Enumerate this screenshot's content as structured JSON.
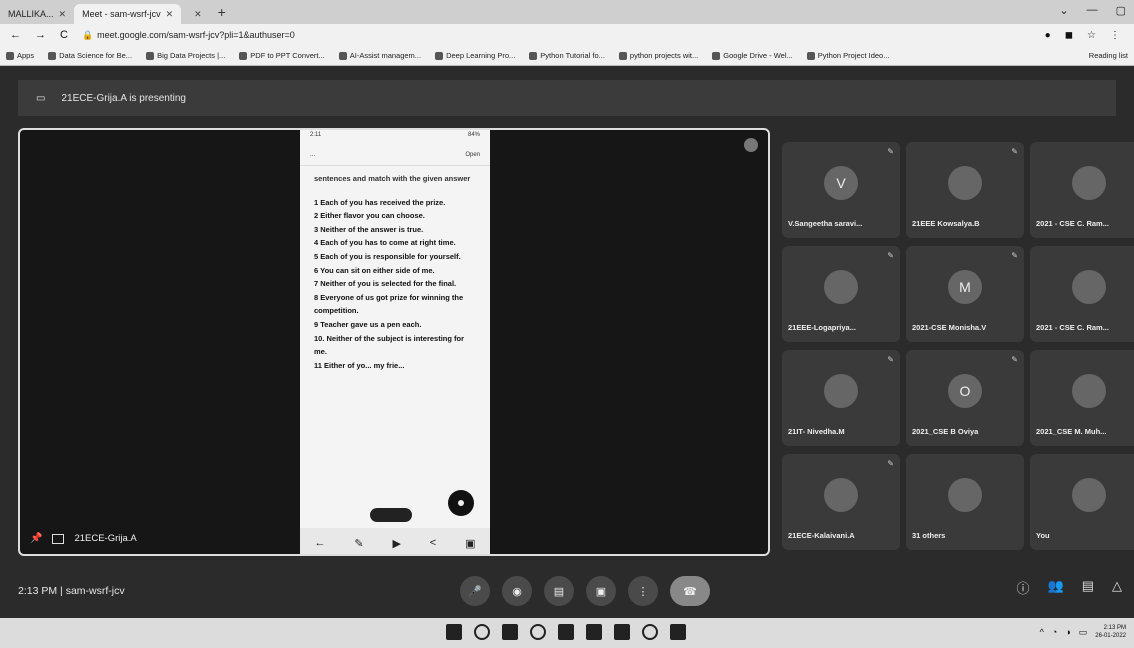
{
  "browser": {
    "tabs": [
      {
        "title": "MALLIKA...",
        "active": false
      },
      {
        "title": "Meet - sam-wsrf-jcv",
        "active": true
      },
      {
        "title": "",
        "active": false
      }
    ],
    "url": "meet.google.com/sam-wsrf-jcv?pli=1&authuser=0",
    "bookmarks": [
      "Apps",
      "Data Science for Be...",
      "Big Data Projects |...",
      "PDF to PPT Convert...",
      "AI-Assist managem...",
      "Deep Learning Pro...",
      "Python Tutorial fo...",
      "python projects wit...",
      "Google Drive - Wel...",
      "Python Project Ideo..."
    ],
    "bookmarks_right": "Reading list"
  },
  "meet": {
    "presenting_text": "21ECE-Grija.A is presenting",
    "presenter_label": "21ECE-Grija.A",
    "meeting_time": "2:13 PM",
    "meeting_code": "sam-wsrf-jcv",
    "participants": [
      {
        "name": "V.Sangeetha saravi...",
        "initial": "V"
      },
      {
        "name": "21EEE Kowsalya.B",
        "initial": ""
      },
      {
        "name": "2021 - CSE C. Ram...",
        "initial": ""
      },
      {
        "name": "21EEE-Logapriya...",
        "initial": ""
      },
      {
        "name": "2021-CSE Monisha.V",
        "initial": "M"
      },
      {
        "name": "2021 - CSE C. Ram...",
        "initial": ""
      },
      {
        "name": "21IT- Nivedha.M",
        "initial": ""
      },
      {
        "name": "2021_CSE B Oviya",
        "initial": "O"
      },
      {
        "name": "2021_CSE M. Muh...",
        "initial": ""
      },
      {
        "name": "21ECE-Kalaivani.A",
        "initial": ""
      },
      {
        "name": "31 others",
        "initial": ""
      },
      {
        "name": "You",
        "initial": ""
      }
    ]
  },
  "phone": {
    "status_time": "2:11",
    "status_right": "84%",
    "header_left": "...",
    "header_right": "Open",
    "instruction": "sentences and match with the given answer",
    "lines": [
      "1 Each of you has received the prize.",
      "2 Either flavor you can choose.",
      "3 Neither of the answer is true.",
      "4 Each of you has to come at right time.",
      "5 Each of you is responsible for yourself.",
      "6 You can sit on either side of me.",
      "7 Neither of you is selected for the final.",
      "8 Everyone of us got prize for winning the competition.",
      "9 Teacher gave us a pen each.",
      "10. Neither of the subject is interesting for me.",
      "11 Either of yo... my frie..."
    ]
  },
  "taskbar": {
    "time": "2:13 PM",
    "date": "26-01-2022"
  }
}
